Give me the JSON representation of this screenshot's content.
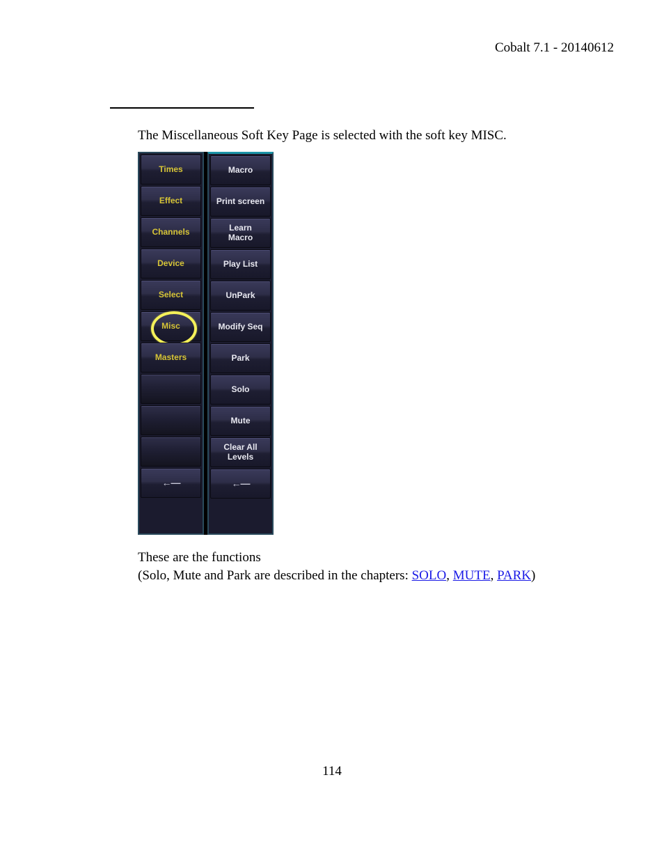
{
  "header": {
    "text": "Cobalt 7.1 - 20140612"
  },
  "intro": {
    "text": "The Miscellaneous Soft Key Page is selected with the soft key MISC."
  },
  "softkeys": {
    "left": [
      {
        "label": "Times",
        "kind": "cat"
      },
      {
        "label": "Effect",
        "kind": "cat"
      },
      {
        "label": "Channels",
        "kind": "cat"
      },
      {
        "label": "Device",
        "kind": "cat"
      },
      {
        "label": "Select",
        "kind": "cat"
      },
      {
        "label": "Misc",
        "kind": "cat",
        "circled": true
      },
      {
        "label": "Masters",
        "kind": "cat"
      },
      {
        "label": "",
        "kind": "empty"
      },
      {
        "label": "",
        "kind": "empty"
      },
      {
        "label": "",
        "kind": "empty"
      },
      {
        "label": "←—",
        "kind": "back"
      }
    ],
    "right": [
      {
        "label": "Macro",
        "kind": "fn"
      },
      {
        "label": "Print screen",
        "kind": "fn"
      },
      {
        "label": "Learn\nMacro",
        "kind": "fn"
      },
      {
        "label": "Play List",
        "kind": "fn"
      },
      {
        "label": "UnPark",
        "kind": "fn"
      },
      {
        "label": "Modify Seq",
        "kind": "fn"
      },
      {
        "label": "Park",
        "kind": "fn"
      },
      {
        "label": "Solo",
        "kind": "fn"
      },
      {
        "label": "Mute",
        "kind": "fn"
      },
      {
        "label": "Clear All\nLevels",
        "kind": "fn"
      },
      {
        "label": "←—",
        "kind": "back"
      }
    ]
  },
  "functions": {
    "line1": "These are the functions",
    "line2_pre": "(Solo, Mute and Park are described in the chapters: ",
    "links": {
      "solo": "SOLO",
      "mute": "MUTE",
      "park": "PARK"
    },
    "sep": ", ",
    "close": ")"
  },
  "page_number": "114"
}
